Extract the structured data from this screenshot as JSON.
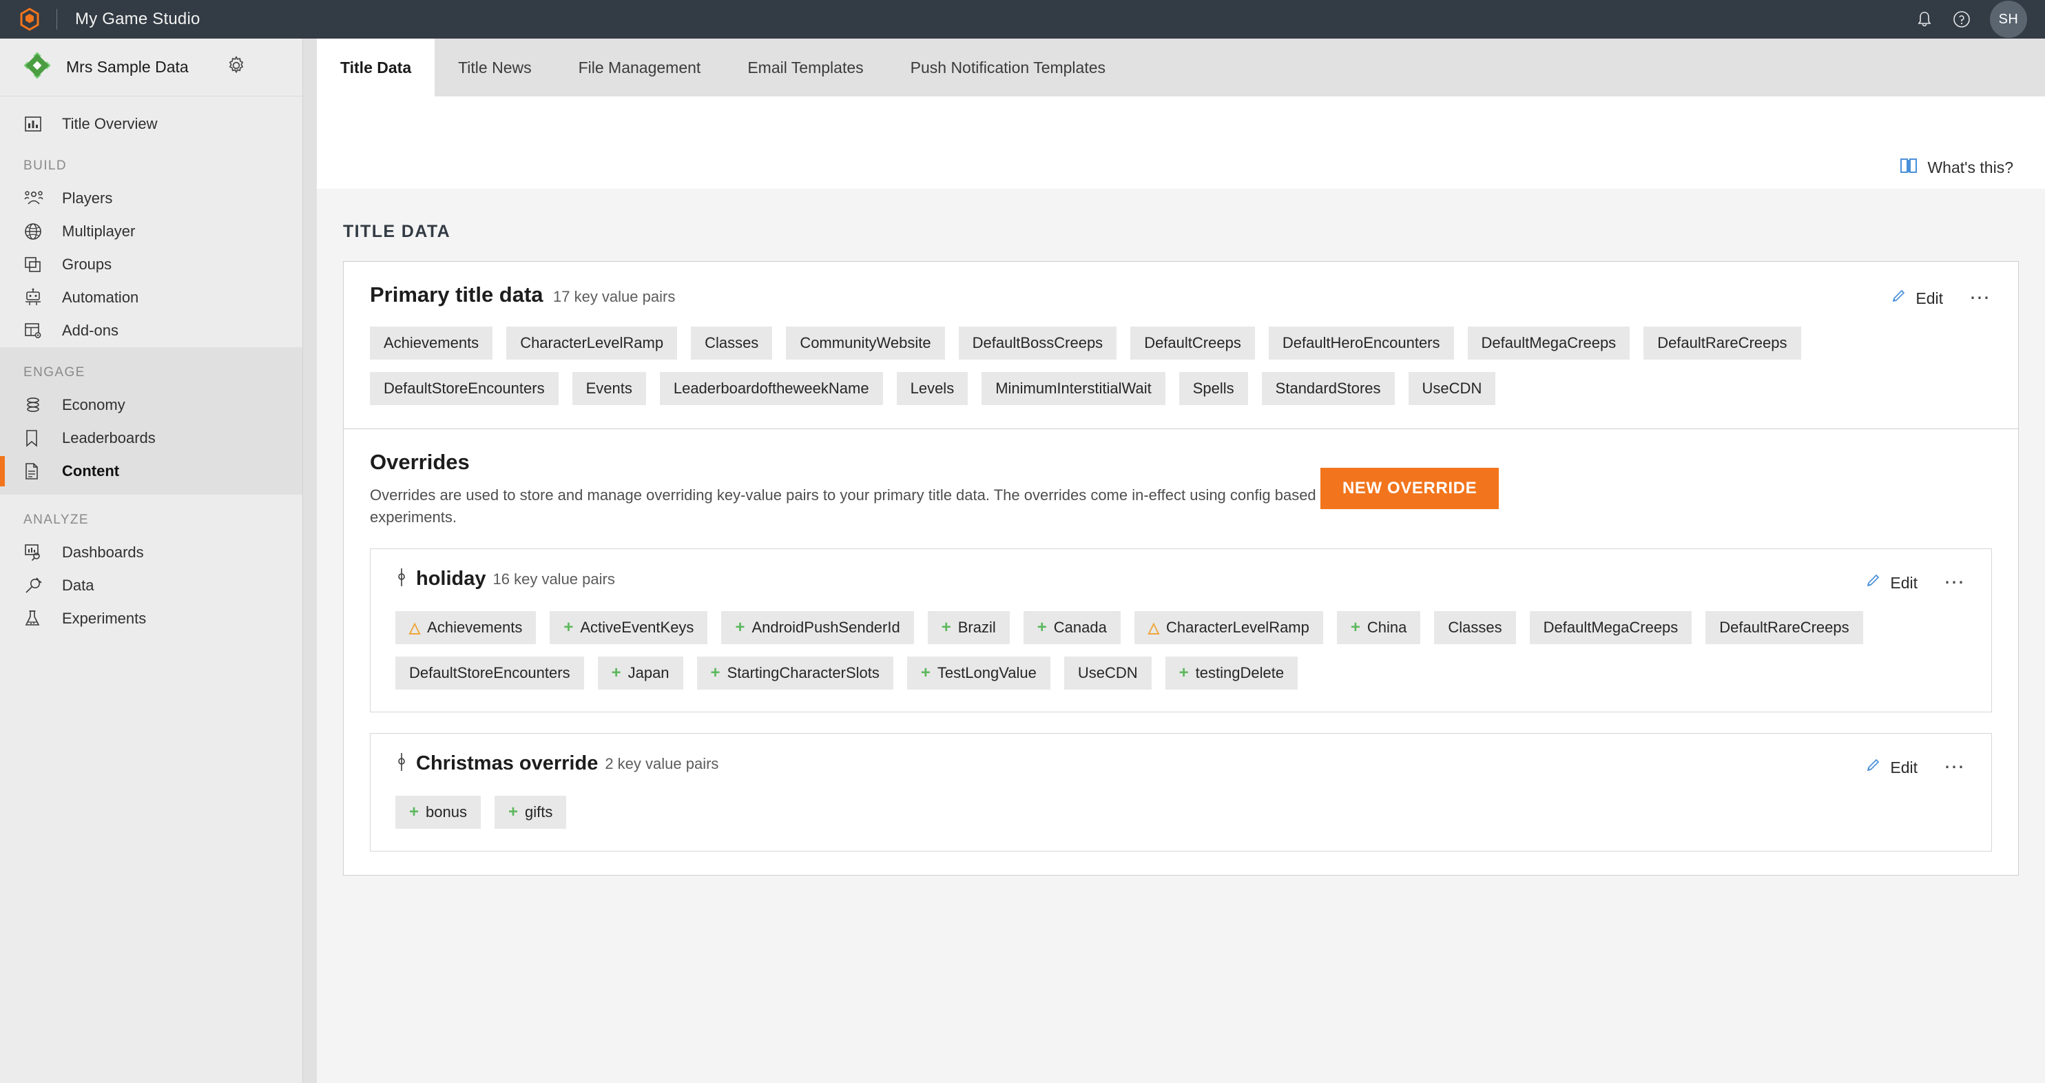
{
  "topbar": {
    "logo_icon": "playfab-hex-logo-icon",
    "title": "My Game Studio",
    "notifications_icon": "bell-icon",
    "help_icon": "question-circle-icon",
    "avatar_initials": "SH",
    "accent_color": "#f2751d",
    "background_color": "#333b44"
  },
  "sidebar": {
    "studio": {
      "icon": "green-diamond-title-icon",
      "name": "Mrs Sample Data",
      "settings_icon": "gear-icon"
    },
    "top_items": [
      {
        "label": "Title Overview",
        "icon": "bar-chart-icon"
      }
    ],
    "groups": [
      {
        "label": "BUILD",
        "active": false,
        "items": [
          {
            "label": "Players",
            "icon": "people-icon"
          },
          {
            "label": "Multiplayer",
            "icon": "globe-icon"
          },
          {
            "label": "Groups",
            "icon": "stacked-windows-icon"
          },
          {
            "label": "Automation",
            "icon": "robot-icon"
          },
          {
            "label": "Add-ons",
            "icon": "table-gear-icon"
          }
        ]
      },
      {
        "label": "ENGAGE",
        "active": true,
        "items": [
          {
            "label": "Economy",
            "icon": "database-icon"
          },
          {
            "label": "Leaderboards",
            "icon": "bookmark-icon"
          },
          {
            "label": "Content",
            "icon": "document-lines-icon",
            "active": true
          }
        ]
      },
      {
        "label": "ANALYZE",
        "active": false,
        "items": [
          {
            "label": "Dashboards",
            "icon": "dashboard-search-icon"
          },
          {
            "label": "Data",
            "icon": "plug-icon"
          },
          {
            "label": "Experiments",
            "icon": "flask-icon"
          }
        ]
      }
    ]
  },
  "tabs": [
    {
      "label": "Title Data",
      "active": true
    },
    {
      "label": "Title News",
      "active": false
    },
    {
      "label": "File Management",
      "active": false
    },
    {
      "label": "Email Templates",
      "active": false
    },
    {
      "label": "Push Notification Templates",
      "active": false
    }
  ],
  "whats_this": {
    "label": "What's this?",
    "icon": "book-icon",
    "icon_color": "#4a90d9"
  },
  "panel": {
    "title": "TITLE DATA"
  },
  "primary_title_data": {
    "heading": "Primary title data",
    "subheading": "17 key value pairs",
    "edit_label": "Edit",
    "edit_icon": "pencil-icon",
    "more_icon": "ellipsis-icon",
    "keys": [
      {
        "label": "Achievements",
        "mark": ""
      },
      {
        "label": "CharacterLevelRamp",
        "mark": ""
      },
      {
        "label": "Classes",
        "mark": ""
      },
      {
        "label": "CommunityWebsite",
        "mark": ""
      },
      {
        "label": "DefaultBossCreeps",
        "mark": ""
      },
      {
        "label": "DefaultCreeps",
        "mark": ""
      },
      {
        "label": "DefaultHeroEncounters",
        "mark": ""
      },
      {
        "label": "DefaultMegaCreeps",
        "mark": ""
      },
      {
        "label": "DefaultRareCreeps",
        "mark": ""
      },
      {
        "label": "DefaultStoreEncounters",
        "mark": ""
      },
      {
        "label": "Events",
        "mark": ""
      },
      {
        "label": "LeaderboardoftheweekName",
        "mark": ""
      },
      {
        "label": "Levels",
        "mark": ""
      },
      {
        "label": "MinimumInterstitialWait",
        "mark": ""
      },
      {
        "label": "Spells",
        "mark": ""
      },
      {
        "label": "StandardStores",
        "mark": ""
      },
      {
        "label": "UseCDN",
        "mark": ""
      }
    ]
  },
  "overrides": {
    "heading": "Overrides",
    "description": "Overrides are used to store and manage overriding key-value pairs to your primary title data. The overrides come in-effect using config based experiments.",
    "new_button_label": "NEW OVERRIDE",
    "new_button_color": "#f2751d",
    "add_mark_color": "#5cb85c",
    "warn_mark_color": "#eda53a",
    "items": [
      {
        "name": "holiday",
        "subheading": "16 key value pairs",
        "branch_icon": "branch-node-icon",
        "edit_label": "Edit",
        "edit_icon": "pencil-icon",
        "more_icon": "ellipsis-icon",
        "keys": [
          {
            "label": "Achievements",
            "mark": "warn"
          },
          {
            "label": "ActiveEventKeys",
            "mark": "add"
          },
          {
            "label": "AndroidPushSenderId",
            "mark": "add"
          },
          {
            "label": "Brazil",
            "mark": "add"
          },
          {
            "label": "Canada",
            "mark": "add"
          },
          {
            "label": "CharacterLevelRamp",
            "mark": "warn"
          },
          {
            "label": "China",
            "mark": "add"
          },
          {
            "label": "Classes",
            "mark": ""
          },
          {
            "label": "DefaultMegaCreeps",
            "mark": ""
          },
          {
            "label": "DefaultRareCreeps",
            "mark": ""
          },
          {
            "label": "DefaultStoreEncounters",
            "mark": ""
          },
          {
            "label": "Japan",
            "mark": "add"
          },
          {
            "label": "StartingCharacterSlots",
            "mark": "add"
          },
          {
            "label": "TestLongValue",
            "mark": "add"
          },
          {
            "label": "UseCDN",
            "mark": ""
          },
          {
            "label": "testingDelete",
            "mark": "add"
          }
        ]
      },
      {
        "name": "Christmas override",
        "subheading": "2 key value pairs",
        "branch_icon": "branch-node-icon",
        "edit_label": "Edit",
        "edit_icon": "pencil-icon",
        "more_icon": "ellipsis-icon",
        "keys": [
          {
            "label": "bonus",
            "mark": "add"
          },
          {
            "label": "gifts",
            "mark": "add"
          }
        ]
      }
    ]
  }
}
